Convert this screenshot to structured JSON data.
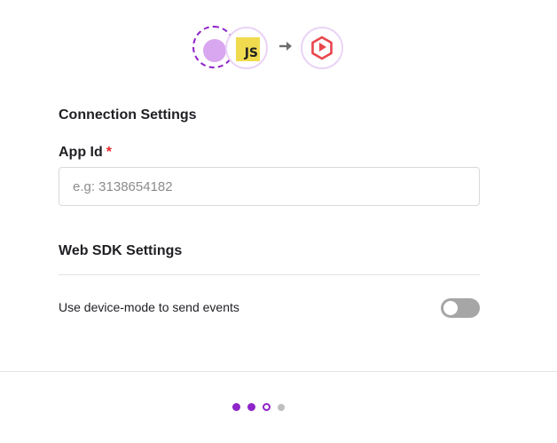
{
  "header": {
    "source_icon": "dashed-circle-source-icon",
    "js_icon_text": "JS",
    "arrow_icon": "arrow-right-icon",
    "destination_icon": "hexagon-destination-logo-icon"
  },
  "connection_settings": {
    "title": "Connection Settings",
    "app_id_label": "App Id",
    "required_mark": "*",
    "app_id_value": "",
    "app_id_placeholder": "e.g: 3138654182"
  },
  "web_sdk_settings": {
    "title": "Web SDK Settings",
    "device_mode_label": "Use device-mode to send events",
    "device_mode_enabled": false
  },
  "stepper": {
    "steps": [
      "done",
      "done",
      "current",
      "todo"
    ]
  },
  "colors": {
    "accent": "#8e24c9",
    "accent_light": "#d9a6f0",
    "required": "#e0272d",
    "js_yellow": "#f0db4f",
    "destination_red": "#e8474c",
    "toggle_off": "#a6a6a6"
  }
}
